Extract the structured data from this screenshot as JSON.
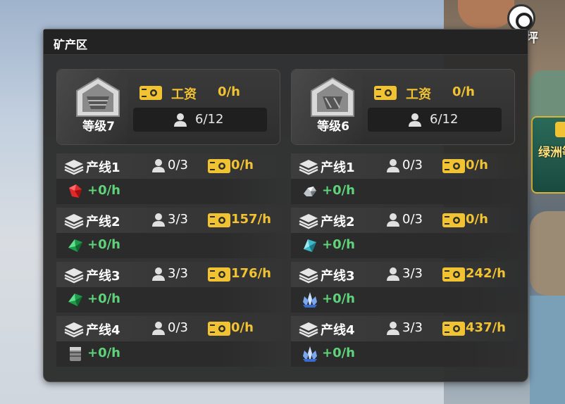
{
  "hud": {
    "label": "坪",
    "side_badge_text": "绿洲等级"
  },
  "panel": {
    "title": "矿产区"
  },
  "zones": [
    {
      "level": "等级7",
      "wage_label": "工资",
      "wage_value": "0/h",
      "workers": "6/12",
      "lines": [
        {
          "name": "产线1",
          "workers": "0/3",
          "wage": "0/h",
          "rate": "+0/h",
          "resource_icon": "red-gem-icon"
        },
        {
          "name": "产线2",
          "workers": "3/3",
          "wage": "157/h",
          "rate": "+0/h",
          "resource_icon": "green-gem-icon"
        },
        {
          "name": "产线3",
          "workers": "3/3",
          "wage": "176/h",
          "rate": "+0/h",
          "resource_icon": "green-gem-icon"
        },
        {
          "name": "产线4",
          "workers": "0/3",
          "wage": "0/h",
          "rate": "+0/h",
          "resource_icon": "metal-ingot-icon"
        }
      ]
    },
    {
      "level": "等级6",
      "wage_label": "工资",
      "wage_value": "0/h",
      "workers": "6/12",
      "lines": [
        {
          "name": "产线1",
          "workers": "0/3",
          "wage": "0/h",
          "rate": "+0/h",
          "resource_icon": "silver-ore-icon"
        },
        {
          "name": "产线2",
          "workers": "0/3",
          "wage": "0/h",
          "rate": "+0/h",
          "resource_icon": "cyan-gem-icon"
        },
        {
          "name": "产线3",
          "workers": "3/3",
          "wage": "242/h",
          "rate": "+0/h",
          "resource_icon": "blue-crystal-icon"
        },
        {
          "name": "产线4",
          "workers": "3/3",
          "wage": "437/h",
          "rate": "+0/h",
          "resource_icon": "blue-crystal-icon"
        }
      ]
    }
  ],
  "colors": {
    "gold": "#f1c232",
    "green": "#5fd37a",
    "panel_bg": "#2c2c2c"
  }
}
